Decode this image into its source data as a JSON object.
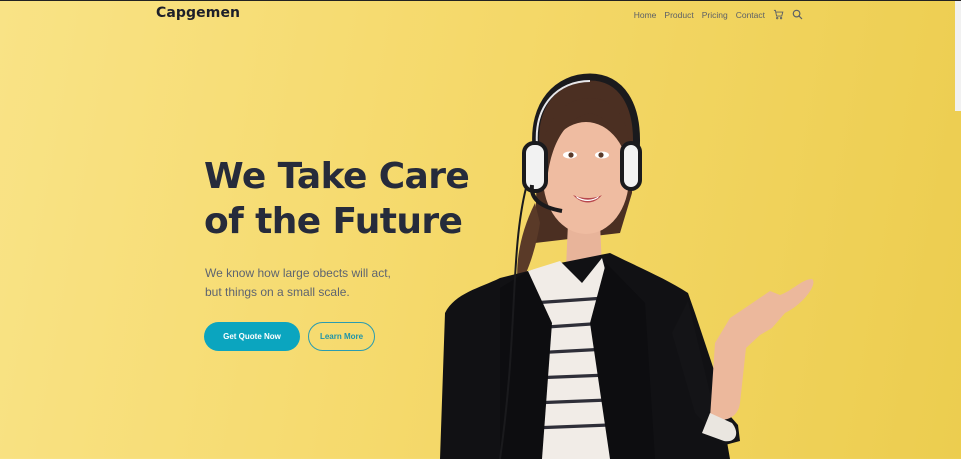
{
  "header": {
    "logo": "Capgemen",
    "nav": [
      "Home",
      "Product",
      "Pricing",
      "Contact"
    ],
    "icons": [
      "cart-icon",
      "search-icon"
    ]
  },
  "hero": {
    "headline_line1": "We Take Care",
    "headline_line2": "of the Future",
    "subtext_line1": "We know how large obects will act,",
    "subtext_line2": "but things on a small scale.",
    "primary_button": "Get Quote Now",
    "secondary_button": "Learn More"
  },
  "colors": {
    "background": "#f5d96b",
    "heading": "#262b3b",
    "primary": "#0ba5bf"
  }
}
